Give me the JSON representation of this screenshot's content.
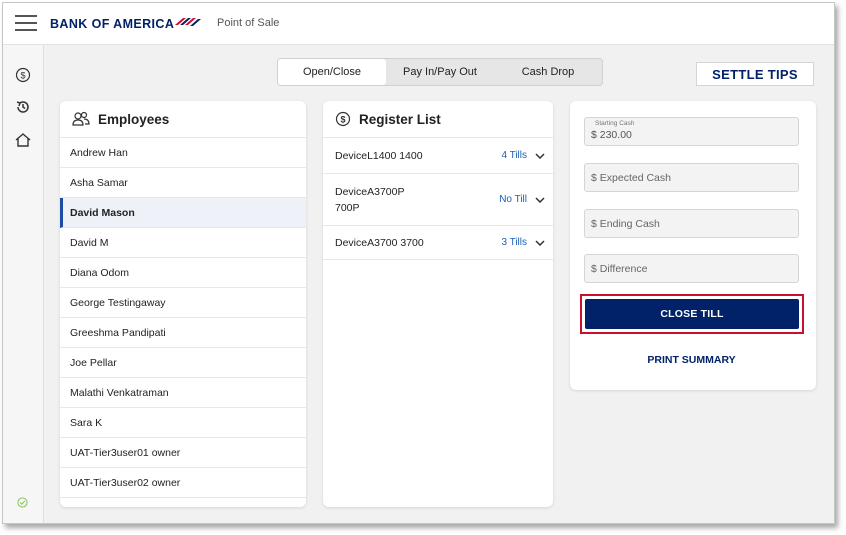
{
  "header": {
    "brand": "BANK OF AMERICA",
    "app_label": "Point of Sale"
  },
  "tabs": [
    {
      "label": "Open/Close",
      "active": true
    },
    {
      "label": "Pay In/Pay Out",
      "active": false
    },
    {
      "label": "Cash Drop",
      "active": false
    }
  ],
  "settle_label": "SETTLE TIPS",
  "employees": {
    "title": "Employees",
    "items": [
      {
        "name": "Andrew Han"
      },
      {
        "name": "Asha Samar"
      },
      {
        "name": "David Mason",
        "selected": true
      },
      {
        "name": "David M"
      },
      {
        "name": "Diana Odom"
      },
      {
        "name": "George Testingaway"
      },
      {
        "name": "Greeshma Pandipati"
      },
      {
        "name": "Joe Pellar"
      },
      {
        "name": "Malathi Venkatraman"
      },
      {
        "name": "Sara K"
      },
      {
        "name": "UAT-Tier3user01 owner"
      },
      {
        "name": "UAT-Tier3user02 owner"
      }
    ]
  },
  "registers": {
    "title": "Register List",
    "items": [
      {
        "name": "DeviceL1400 1400",
        "tills": "4 Tills"
      },
      {
        "name": "DeviceA3700P 700P",
        "tills": "No Till"
      },
      {
        "name": "DeviceA3700 3700",
        "tills": "3 Tills"
      }
    ]
  },
  "cash": {
    "starting_label": "Starting Cash",
    "starting_value": "$ 230.00",
    "expected_placeholder": "$ Expected Cash",
    "ending_placeholder": "$ Ending Cash",
    "difference_placeholder": "$ Difference",
    "close_label": "CLOSE TILL",
    "print_label": "PRINT SUMMARY"
  },
  "colors": {
    "brand_navy": "#012169",
    "brand_red": "#c8102e",
    "link_blue": "#1b5fb8"
  },
  "icons": {
    "menu": "hamburger-icon",
    "dollar": "dollar-circle-icon",
    "history": "history-icon",
    "home": "home-icon",
    "people": "people-icon",
    "chevron": "chevron-down-icon",
    "status": "check-circle-icon"
  }
}
